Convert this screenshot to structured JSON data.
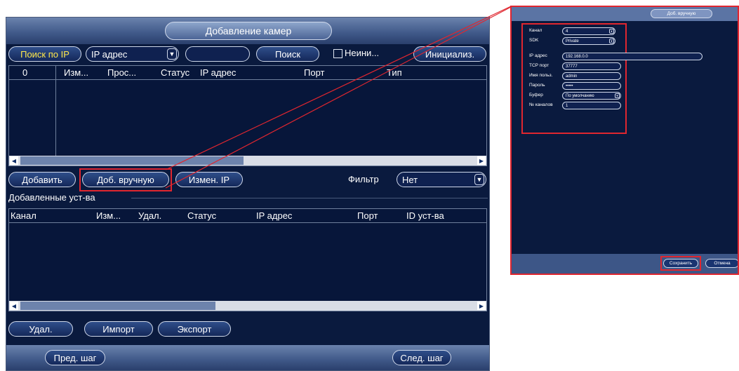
{
  "window": {
    "title": "Добавление камер"
  },
  "search": {
    "search_ip_button": "Поиск по IP",
    "mode_value": "IP адрес",
    "ip_field_value": "",
    "search_button": "Поиск",
    "uninit_label": "Неини...",
    "initialize_button": "Инициализ."
  },
  "found_table": {
    "headers": [
      "0",
      "Изм...",
      "Прос...",
      "Статус",
      "IP адрес",
      "Порт",
      "Тип"
    ]
  },
  "actions": {
    "add_button": "Добавить",
    "manual_add_button": "Доб. вручную",
    "change_ip_button": "Измен. IP",
    "filter_label": "Фильтр",
    "filter_value": "Нет"
  },
  "added_section": {
    "title": "Добавленные уст-ва",
    "headers": [
      "Канал",
      "Изм...",
      "Удал.",
      "Статус",
      "IP адрес",
      "Порт",
      "ID уст-ва"
    ]
  },
  "bottom_actions": {
    "delete_button": "Удал.",
    "import_button": "Импорт",
    "export_button": "Экспорт"
  },
  "nav": {
    "prev_button": "Пред. шаг",
    "next_button": "След. шаг"
  },
  "manual_dialog": {
    "title": "Доб. вручную",
    "fields": [
      {
        "label": "Канал",
        "value": "4"
      },
      {
        "label": "SDK",
        "value": "Private"
      },
      {
        "label": "IP адрес",
        "value": "192.168.0.0"
      },
      {
        "label": "TCP порт",
        "value": "37777"
      },
      {
        "label": "Имя польз.",
        "value": "admin"
      },
      {
        "label": "Пароль",
        "value": "•••••"
      },
      {
        "label": "Буфер",
        "value": "По умолчанию"
      },
      {
        "label": "№ каналов",
        "value": "1"
      }
    ],
    "save_button": "Сохранить",
    "cancel_button": "Отмена"
  },
  "colors": {
    "background": "#0a1a3e",
    "bar": "#3f5888",
    "highlight": "#e0262f",
    "active_text": "#ffe84a"
  }
}
